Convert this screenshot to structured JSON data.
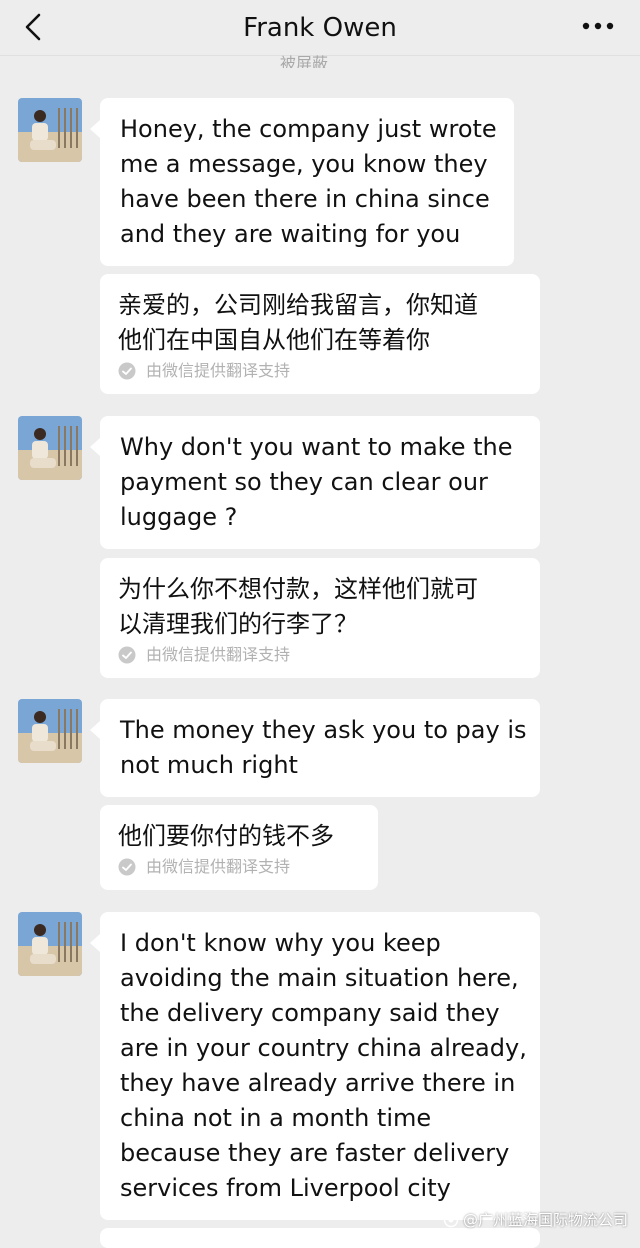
{
  "header": {
    "title": "Frank Owen",
    "cut_label": "被屏蔽"
  },
  "messages": [
    {
      "lines": [
        "Honey, the company just wrote",
        "me a message, you know they",
        "have been there in china since",
        "and they are waiting for you"
      ],
      "translation": [
        "亲爱的，公司刚给我留言，你知道",
        "他们在中国自从他们在等着你"
      ],
      "credit": "由微信提供翻译支持"
    },
    {
      "lines": [
        "Why don't you want to make the",
        "payment so they can clear our",
        "luggage ?"
      ],
      "translation": [
        "为什么你不想付款，这样他们就可",
        "以清理我们的行李了？"
      ],
      "credit": "由微信提供翻译支持"
    },
    {
      "lines": [
        "The money they ask you to pay is",
        "not much right"
      ],
      "translation": [
        "他们要你付的钱不多"
      ],
      "credit": "由微信提供翻译支持"
    },
    {
      "lines": [
        "I don't know why you keep",
        "avoiding the main situation here,",
        "the delivery company said they",
        "are in your country china already,",
        "they have already arrive there in",
        "china not in a month time",
        "because they are faster delivery",
        "services from Liverpool city"
      ]
    }
  ],
  "watermark": "@广州蓝海国际物流公司",
  "colors": {
    "background": "#ededed",
    "bubble": "#ffffff",
    "credit_text": "#b2b2b2"
  }
}
